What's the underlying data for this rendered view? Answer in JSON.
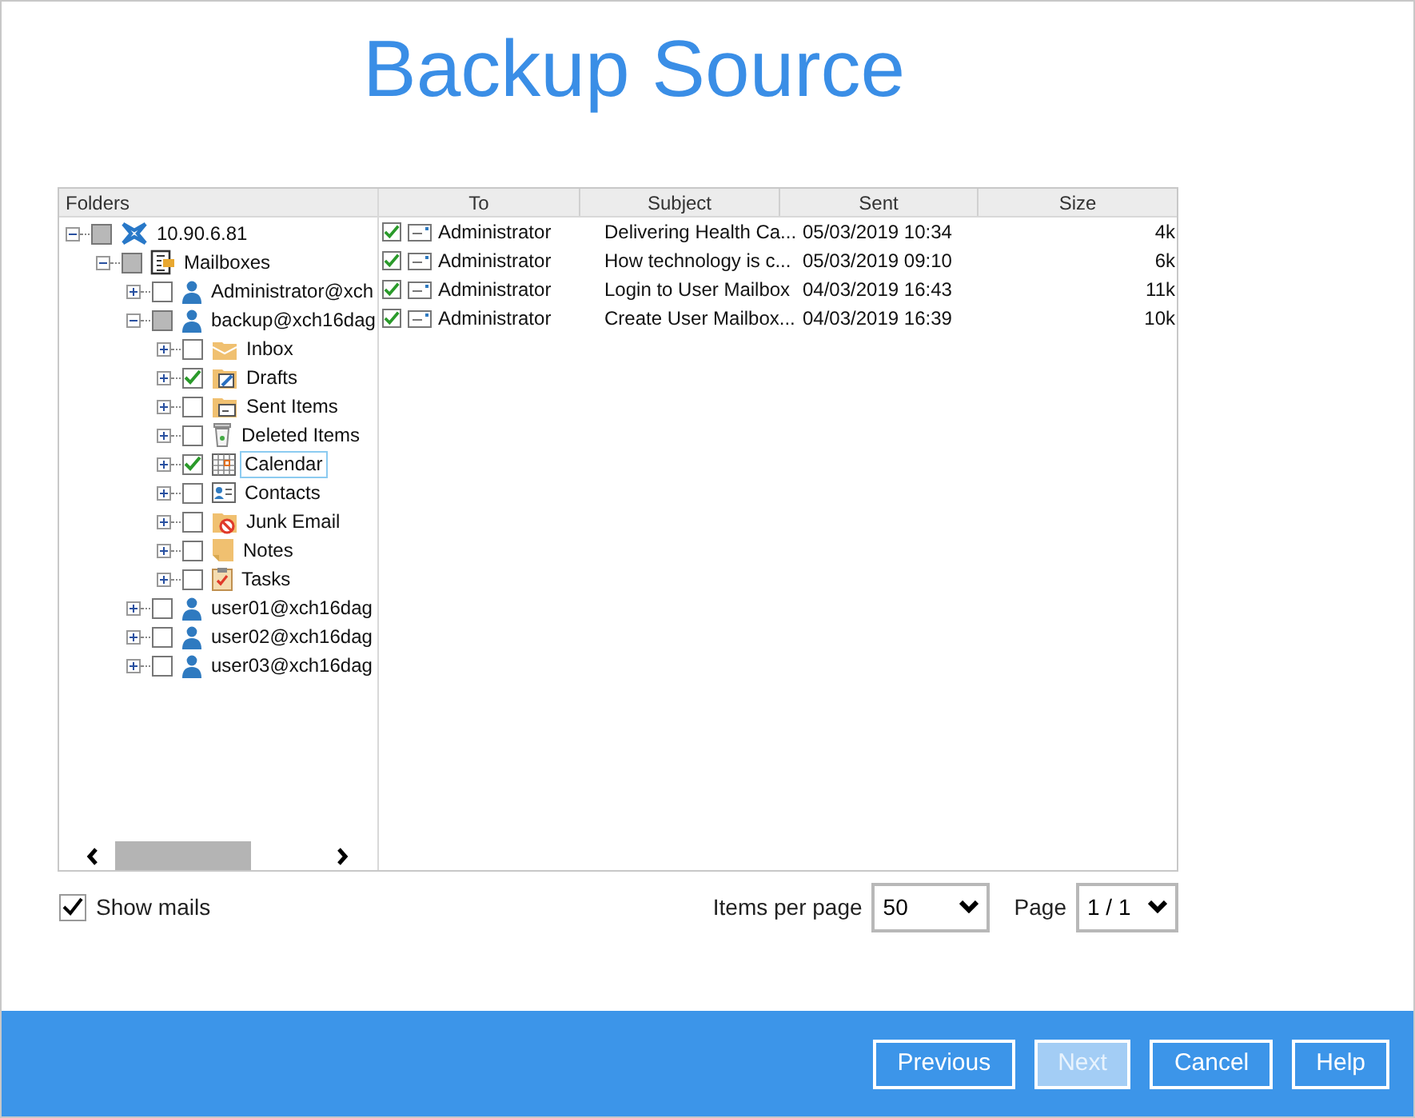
{
  "title": "Backup Source",
  "folders": {
    "header": "Folders",
    "tree": [
      {
        "label": "10.90.6.81",
        "kind": "server",
        "expanded": true,
        "checked": false,
        "partial": true,
        "selected": false,
        "children": [
          {
            "label": "Mailboxes",
            "kind": "mailboxes",
            "expanded": true,
            "checked": false,
            "partial": true,
            "selected": false,
            "children": [
              {
                "label": "Administrator@xch",
                "kind": "user",
                "expanded": false,
                "checked": false,
                "partial": false,
                "selected": false
              },
              {
                "label": "backup@xch16dag",
                "kind": "user",
                "expanded": true,
                "checked": false,
                "partial": true,
                "selected": false,
                "children": [
                  {
                    "label": "Inbox",
                    "kind": "inbox",
                    "expanded": false,
                    "checked": false,
                    "partial": false,
                    "selected": false
                  },
                  {
                    "label": "Drafts",
                    "kind": "drafts",
                    "expanded": false,
                    "checked": true,
                    "selected": false
                  },
                  {
                    "label": "Sent Items",
                    "kind": "sent",
                    "expanded": false,
                    "checked": false,
                    "partial": false,
                    "selected": false
                  },
                  {
                    "label": "Deleted Items",
                    "kind": "deleted",
                    "expanded": false,
                    "checked": false,
                    "partial": false,
                    "selected": false
                  },
                  {
                    "label": "Calendar",
                    "kind": "calendar",
                    "expanded": false,
                    "checked": true,
                    "selected": true
                  },
                  {
                    "label": "Contacts",
                    "kind": "contacts",
                    "expanded": false,
                    "checked": false,
                    "partial": false,
                    "selected": false
                  },
                  {
                    "label": "Junk Email",
                    "kind": "junk",
                    "expanded": false,
                    "checked": false,
                    "partial": false,
                    "selected": false
                  },
                  {
                    "label": "Notes",
                    "kind": "notes",
                    "expanded": false,
                    "checked": false,
                    "partial": false,
                    "selected": false
                  },
                  {
                    "label": "Tasks",
                    "kind": "tasks",
                    "expanded": false,
                    "checked": false,
                    "partial": false,
                    "selected": false
                  }
                ]
              },
              {
                "label": "user01@xch16dag",
                "kind": "user",
                "expanded": false,
                "checked": false,
                "partial": false,
                "selected": false
              },
              {
                "label": "user02@xch16dag",
                "kind": "user",
                "expanded": false,
                "checked": false,
                "partial": false,
                "selected": false
              },
              {
                "label": "user03@xch16dag",
                "kind": "user",
                "expanded": false,
                "checked": false,
                "partial": false,
                "selected": false
              }
            ]
          }
        ]
      }
    ]
  },
  "mails": {
    "columns": [
      "To",
      "Subject",
      "Sent",
      "Size"
    ],
    "rows": [
      {
        "checked": true,
        "to": "Administrator",
        "subject": "Delivering Health Ca...",
        "sent": "05/03/2019 10:34",
        "size": "4k"
      },
      {
        "checked": true,
        "to": "Administrator",
        "subject": "How technology is c...",
        "sent": "05/03/2019 09:10",
        "size": "6k"
      },
      {
        "checked": true,
        "to": "Administrator",
        "subject": "Login to User Mailbox",
        "sent": "04/03/2019 16:43",
        "size": "11k"
      },
      {
        "checked": true,
        "to": "Administrator",
        "subject": "Create User Mailbox...",
        "sent": "04/03/2019 16:39",
        "size": "10k"
      }
    ]
  },
  "show_mails": {
    "label": "Show mails",
    "checked": true
  },
  "items_per_page": {
    "label": "Items per page",
    "value": "50"
  },
  "page": {
    "label": "Page",
    "value": "1 / 1"
  },
  "buttons": [
    {
      "label": "Previous",
      "disabled": false
    },
    {
      "label": "Next",
      "disabled": true
    },
    {
      "label": "Cancel",
      "disabled": false
    },
    {
      "label": "Help",
      "disabled": false
    }
  ]
}
